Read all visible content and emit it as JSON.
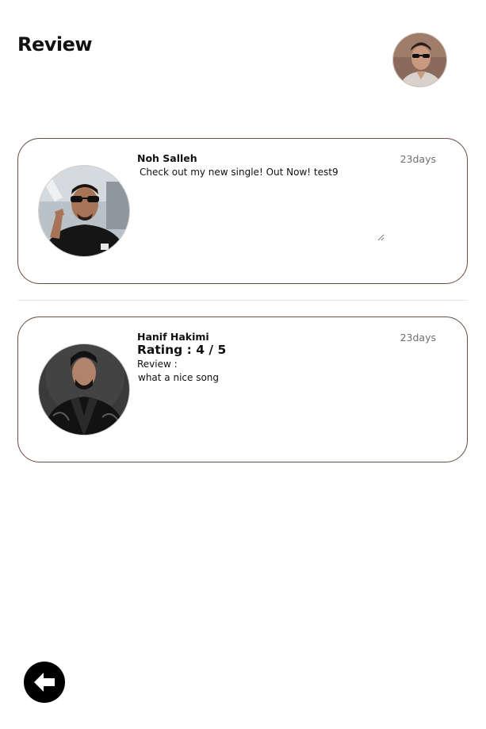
{
  "header": {
    "title": "Review"
  },
  "reviews": [
    {
      "author": "Noh Salleh",
      "time": "23days",
      "comment": "Check out my new single! Out Now! test9"
    },
    {
      "author": "Hanif Hakimi",
      "time": "23days",
      "rating": "Rating : 4 / 5",
      "review_label": "Review :",
      "review_text": "what a nice song"
    }
  ],
  "icons": {
    "back": "arrow-left-circle-icon"
  },
  "colors": {
    "card_border": "#6b4a3f",
    "time_text": "#6f6f6f",
    "back_button": "#000000"
  }
}
